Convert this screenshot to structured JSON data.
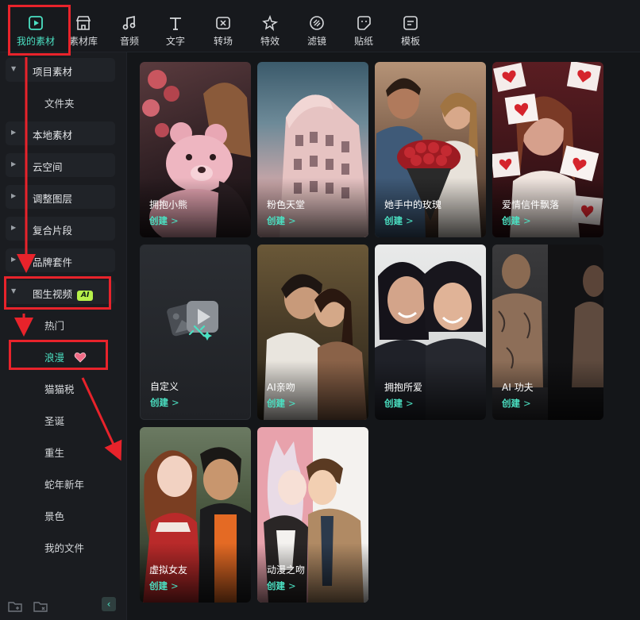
{
  "toolbar": {
    "items": [
      {
        "label": "我的素材",
        "icon": "play-square-icon"
      },
      {
        "label": "素材库",
        "icon": "store-icon"
      },
      {
        "label": "音频",
        "icon": "music-note-icon"
      },
      {
        "label": "文字",
        "icon": "text-t-icon"
      },
      {
        "label": "转场",
        "icon": "transition-icon"
      },
      {
        "label": "特效",
        "icon": "sparkle-star-icon"
      },
      {
        "label": "滤镜",
        "icon": "filter-icon"
      },
      {
        "label": "贴纸",
        "icon": "sticker-icon"
      },
      {
        "label": "模板",
        "icon": "template-icon"
      }
    ],
    "active_index": 0
  },
  "sidebar": {
    "project_assets": "项目素材",
    "folder": "文件夹",
    "local_assets": "本地素材",
    "cloud": "云空间",
    "adjust_layer": "调整图层",
    "compound_clip": "复合片段",
    "brand_kit": "品牌套件",
    "image_to_video": "图生视频",
    "ai_badge": "AI",
    "sub_items": [
      "热门",
      "浪漫",
      "猫猫税",
      "圣诞",
      "重生",
      "蛇年新年",
      "景色",
      "我的文件"
    ],
    "selected_sub": "浪漫"
  },
  "cards": [
    {
      "title": "拥抱小熊",
      "action": "创建"
    },
    {
      "title": "粉色天堂",
      "action": "创建"
    },
    {
      "title": "她手中的玫瑰",
      "action": "创建"
    },
    {
      "title": "爱情信件飘落",
      "action": "创建"
    },
    {
      "title": "自定义",
      "action": "创建"
    },
    {
      "title": "AI亲吻",
      "action": "创建"
    },
    {
      "title": "拥抱所爱",
      "action": "创建"
    },
    {
      "title": "AI 功夫",
      "action": "创建"
    },
    {
      "title": "虚拟女友",
      "action": "创建"
    },
    {
      "title": "动漫之吻",
      "action": "创建"
    }
  ],
  "colors": {
    "accent": "#4be0c2",
    "annotation": "#e8232b",
    "ai_badge": "#b6f04a",
    "background": "#141619"
  }
}
